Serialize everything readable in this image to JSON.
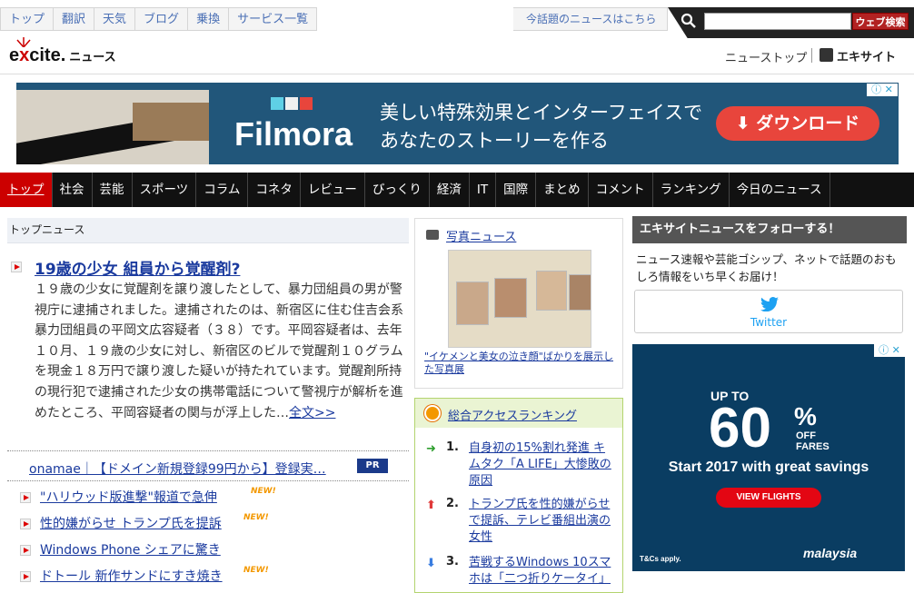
{
  "toplinks": [
    "トップ",
    "翻訳",
    "天気",
    "ブログ",
    "乗換",
    "サービス一覧"
  ],
  "hot_news_link": "今話題のニュースはこちら",
  "search": {
    "button": "ウェブ検索"
  },
  "logo": {
    "x": "x",
    "e1": "e",
    "cite": "cite.",
    "news": "ニュース"
  },
  "header_links": {
    "news_top": "ニューストップ",
    "excite": "エキサイト"
  },
  "banner_ad": {
    "brand": "Filmora",
    "line1": "美しい特殊効果とインターフェイスで",
    "line2": "あなたのストーリーを作る",
    "cta": "ダウンロード",
    "badge": "ⓘ ✕"
  },
  "nav": [
    "トップ",
    "社会",
    "芸能",
    "スポーツ",
    "コラム",
    "コネタ",
    "レビュー",
    "びっくり",
    "経済",
    "IT",
    "国際",
    "まとめ",
    "コメント",
    "ランキング",
    "今日のニュース"
  ],
  "top_news": {
    "header": "トップニュース",
    "headline": "19歳の少女 組員から覚醒剤?",
    "body": "１９歳の少女に覚醒剤を譲り渡したとして、暴力団組員の男が警視庁に逮捕されました。逮捕されたのは、新宿区に住む住吉会系暴力団組員の平岡文広容疑者（３８）です。平岡容疑者は、去年１０月、１９歳の少女に対し、新宿区のビルで覚醒剤１０グラムを現金１８万円で譲り渡した疑いが持たれています。覚醒剤所持の現行犯で逮捕された少女の携帯電話について警視庁が解析を進めたところ、平岡容疑者の関与が浮上した…",
    "more": "全文>>",
    "pr_text": "onamae｜【ドメイン新規登録99円から】登録実…",
    "pr_badge": "PR",
    "items": [
      {
        "text": "\"ハリウッド版進撃\"報道で急伸",
        "new": "NEW!"
      },
      {
        "text": "性的嫌がらせ トランプ氏を提訴",
        "new": "NEW!"
      },
      {
        "text": "Windows Phone シェアに驚き",
        "new": ""
      },
      {
        "text": "ドトール 新作サンドにすき焼き",
        "new": "NEW!"
      }
    ]
  },
  "photo_news": {
    "title": "写真ニュース",
    "caption": "\"イケメンと美女の泣き顔\"ばかりを展示した写真展"
  },
  "ranking": {
    "title": "総合アクセスランキング",
    "items": [
      {
        "num": "1.",
        "arrow": "➜",
        "arrow_color": "#2e9e2e",
        "text": "自身初の15%割れ発進 キムタク「A LIFE」大惨敗の原因"
      },
      {
        "num": "2.",
        "arrow": "⬆",
        "arrow_color": "#e03a3a",
        "text": "トランプ氏を性的嫌がらせで提訴、テレビ番組出演の女性"
      },
      {
        "num": "3.",
        "arrow": "⬇",
        "arrow_color": "#3a7de0",
        "text": "苦戦するWindows 10スマホは「二つ折りケータイ」"
      }
    ]
  },
  "follow": {
    "header": "エキサイトニュースをフォローする！",
    "text": "ニュース速報や芸能ゴシップ、ネットで話題のおもしろ情報をいち早くお届け！",
    "twitter": "Twitter"
  },
  "side_ad": {
    "upto": "UP TO",
    "number": "60",
    "pct": "%",
    "off1": "OFF",
    "off2": "FARES",
    "start": "Start 2017 with great savings",
    "cta": "VIEW FLIGHTS",
    "tc": "T&Cs apply.",
    "brand": "malaysia",
    "badge": "ⓘ ✕"
  },
  "colors": {
    "accent_red": "#cc0000",
    "link_blue": "#1a3a9e",
    "nav_bg": "#111111"
  }
}
